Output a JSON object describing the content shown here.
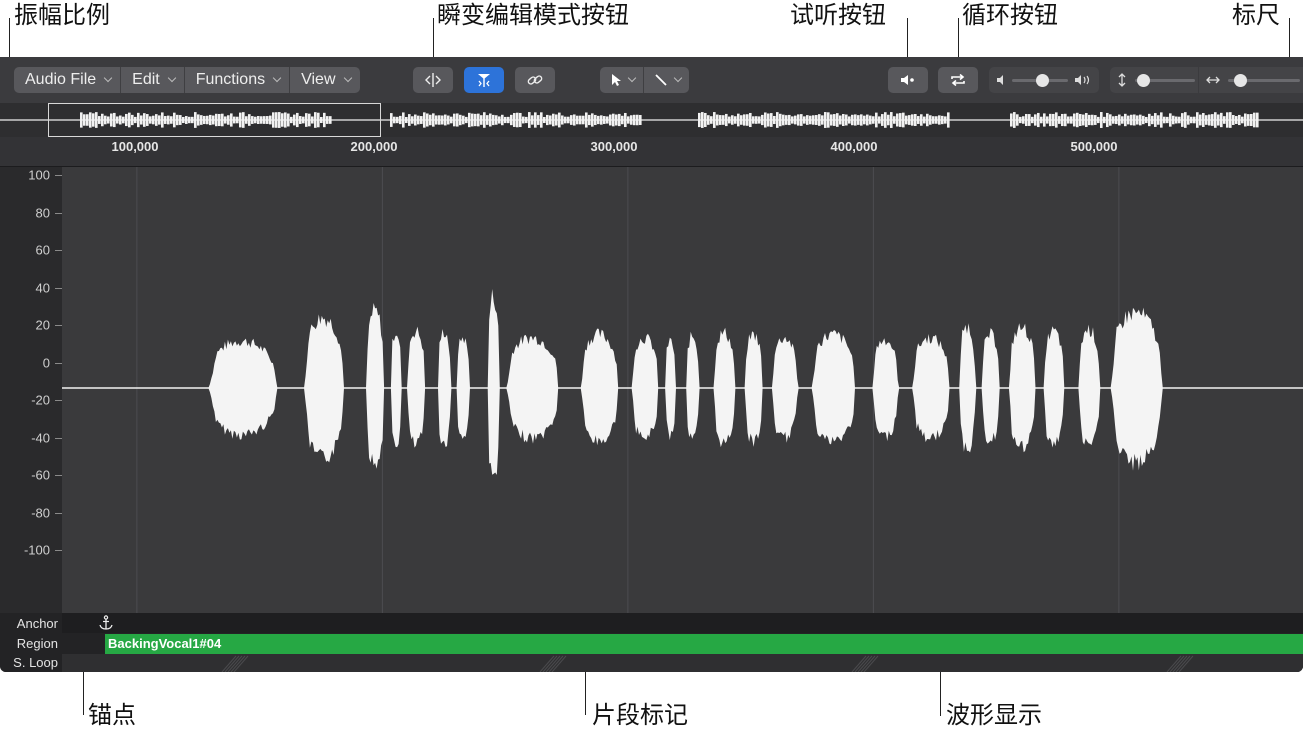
{
  "callouts": {
    "amplitude_scale": "振幅比例",
    "flex_mode_button": "瞬变编辑模式按钮",
    "preview_button": "试听按钮",
    "loop_button": "循环按钮",
    "ruler": "标尺",
    "anchor": "锚点",
    "region_markers": "片段标记",
    "waveform_display": "波形显示"
  },
  "toolbar": {
    "menus": [
      "Audio File",
      "Edit",
      "Functions",
      "View"
    ],
    "flex_mode_icon": "transient-edit-icon",
    "snap_icon": "flex-marker-icon",
    "link_icon": "link-icon",
    "pointer_tool_icon": "pointer-icon",
    "pencil_tool_icon": "pencil-icon",
    "preview_icon": "speaker-preview-icon",
    "loop_icon": "loop-icon",
    "volume_level": 0.55,
    "vertical_zoom_level": 0.15,
    "horizontal_zoom_level": 0.2
  },
  "ruler": {
    "ticks": [
      "100,000",
      "200,000",
      "300,000",
      "400,000",
      "500,000"
    ],
    "tick_values": [
      100000,
      200000,
      300000,
      400000,
      500000
    ],
    "range": [
      69500,
      575000
    ]
  },
  "amplitude": {
    "labels": [
      "100",
      "80",
      "60",
      "40",
      "20",
      "0",
      "-20",
      "-40",
      "-60",
      "-80",
      "-100"
    ],
    "values": [
      100,
      80,
      60,
      40,
      20,
      0,
      -20,
      -40,
      -60,
      -80,
      -100
    ]
  },
  "bottom": {
    "anchor_label": "Anchor",
    "region_label": "Region",
    "sloop_label": "S. Loop",
    "region_name": "BackingVocal1#04"
  },
  "waveform": {
    "segments": [
      {
        "start_pct": 0.118,
        "end_pct": 0.182,
        "peak": 28
      },
      {
        "start_pct": 0.195,
        "end_pct": 0.232,
        "peak": 42
      },
      {
        "start_pct": 0.245,
        "end_pct": 0.262,
        "peak": 46
      },
      {
        "start_pct": 0.265,
        "end_pct": 0.275,
        "peak": 34
      },
      {
        "start_pct": 0.278,
        "end_pct": 0.295,
        "peak": 34
      },
      {
        "start_pct": 0.303,
        "end_pct": 0.315,
        "peak": 34
      },
      {
        "start_pct": 0.318,
        "end_pct": 0.33,
        "peak": 30
      },
      {
        "start_pct": 0.343,
        "end_pct": 0.354,
        "peak": 55
      },
      {
        "start_pct": 0.358,
        "end_pct": 0.407,
        "peak": 30
      },
      {
        "start_pct": 0.418,
        "end_pct": 0.453,
        "peak": 32
      },
      {
        "start_pct": 0.459,
        "end_pct": 0.484,
        "peak": 30
      },
      {
        "start_pct": 0.486,
        "end_pct": 0.496,
        "peak": 28
      },
      {
        "start_pct": 0.503,
        "end_pct": 0.515,
        "peak": 31
      },
      {
        "start_pct": 0.525,
        "end_pct": 0.545,
        "peak": 33
      },
      {
        "start_pct": 0.55,
        "end_pct": 0.567,
        "peak": 32
      },
      {
        "start_pct": 0.572,
        "end_pct": 0.596,
        "peak": 30
      },
      {
        "start_pct": 0.604,
        "end_pct": 0.645,
        "peak": 32
      },
      {
        "start_pct": 0.653,
        "end_pct": 0.677,
        "peak": 29
      },
      {
        "start_pct": 0.685,
        "end_pct": 0.72,
        "peak": 30
      },
      {
        "start_pct": 0.723,
        "end_pct": 0.738,
        "peak": 37
      },
      {
        "start_pct": 0.741,
        "end_pct": 0.758,
        "peak": 32
      },
      {
        "start_pct": 0.763,
        "end_pct": 0.788,
        "peak": 36
      },
      {
        "start_pct": 0.791,
        "end_pct": 0.81,
        "peak": 34
      },
      {
        "start_pct": 0.819,
        "end_pct": 0.839,
        "peak": 35
      },
      {
        "start_pct": 0.845,
        "end_pct": 0.893,
        "peak": 45
      }
    ]
  }
}
